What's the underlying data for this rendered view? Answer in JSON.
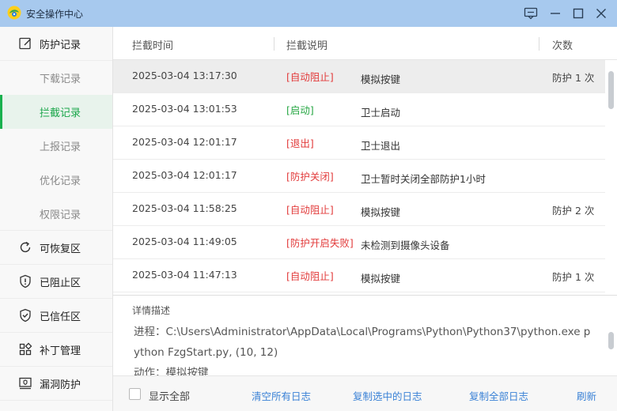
{
  "window": {
    "title": "安全操作中心",
    "brand_color": "#a7c9ee"
  },
  "sidebar": {
    "items": [
      {
        "label": "防护记录",
        "icon": "edit-icon"
      },
      {
        "label": "下载记录"
      },
      {
        "label": "拦截记录",
        "active": true
      },
      {
        "label": "上报记录"
      },
      {
        "label": "优化记录"
      },
      {
        "label": "权限记录"
      },
      {
        "label": "可恢复区",
        "icon": "restore-icon"
      },
      {
        "label": "已阻止区",
        "icon": "shield-blocked-icon"
      },
      {
        "label": "已信任区",
        "icon": "shield-check-icon"
      },
      {
        "label": "补丁管理",
        "icon": "apps-grid-icon"
      },
      {
        "label": "漏洞防护",
        "icon": "monitor-shield-icon"
      }
    ]
  },
  "table": {
    "headers": [
      "拦截时间",
      "拦截说明",
      "次数"
    ],
    "rows": [
      {
        "time": "2025-03-04 13:17:30",
        "type": "[自动阻止]",
        "desc": "模拟按键",
        "count": "防护 1 次",
        "type_color": "#e23b3b"
      },
      {
        "time": "2025-03-04 13:01:53",
        "type": "[启动]",
        "desc": "卫士启动",
        "count": "",
        "type_color": "#27a744"
      },
      {
        "time": "2025-03-04 12:01:17",
        "type": "[退出]",
        "desc": "卫士退出",
        "count": "",
        "type_color": "#e23b3b"
      },
      {
        "time": "2025-03-04 12:01:17",
        "type": "[防护关闭]",
        "desc": "卫士暂时关闭全部防护1小时",
        "count": "",
        "type_color": "#e23b3b"
      },
      {
        "time": "2025-03-04 11:58:25",
        "type": "[自动阻止]",
        "desc": "模拟按键",
        "count": "防护 2 次",
        "type_color": "#e23b3b"
      },
      {
        "time": "2025-03-04 11:49:05",
        "type": "[防护开启失败]",
        "desc": "未检测到摄像头设备",
        "count": "",
        "type_color": "#e23b3b"
      },
      {
        "time": "2025-03-04 11:47:13",
        "type": "[自动阻止]",
        "desc": "模拟按键",
        "count": "防护 1 次",
        "type_color": "#e23b3b"
      }
    ]
  },
  "detail": {
    "title": "详情描述",
    "text": "进程：C:\\Users\\Administrator\\AppData\\Local\\Programs\\Python\\Python37\\python.exe python FzgStart.py, (10, 12)",
    "text_line2": "动作：模拟按键"
  },
  "footer": {
    "show_all_label": "显示全部",
    "show_all_checked": false,
    "clear_all": "清空所有日志",
    "copy_selected": "复制选中的日志",
    "copy_all": "复制全部日志",
    "refresh": "刷新",
    "link_color": "#3b82d6"
  }
}
